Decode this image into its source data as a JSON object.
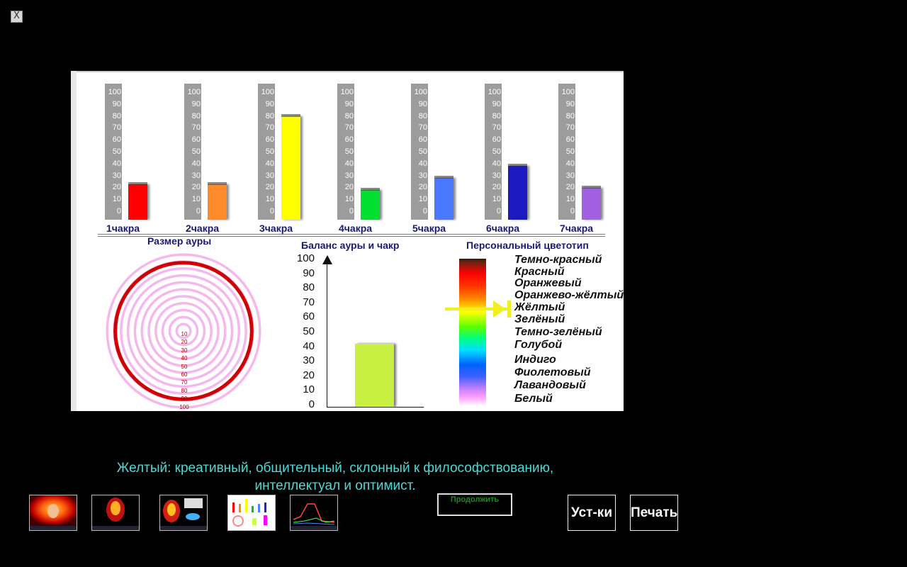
{
  "window": {
    "close_glyph": "X"
  },
  "chakras": {
    "scale_ticks": [
      "100",
      "90",
      "80",
      "70",
      "60",
      "50",
      "40",
      "30",
      "20",
      "10",
      "0"
    ],
    "items": [
      {
        "label": "1чакра",
        "value": 30,
        "color": "#ff0000"
      },
      {
        "label": "2чакра",
        "value": 30,
        "color": "#ff8a2a"
      },
      {
        "label": "3чакра",
        "value": 87,
        "color": "#ffff00"
      },
      {
        "label": "4чакра",
        "value": 25,
        "color": "#00e030"
      },
      {
        "label": "5чакра",
        "value": 35,
        "color": "#4a78ff"
      },
      {
        "label": "6чакра",
        "value": 45,
        "color": "#1a1ac0"
      },
      {
        "label": "7чакра",
        "value": 27,
        "color": "#a060e0"
      }
    ]
  },
  "aura": {
    "title": "Размер ауры",
    "ticks": [
      "10",
      "20",
      "30",
      "40",
      "50",
      "60",
      "70",
      "80",
      "90",
      "100"
    ],
    "ring_value": 90,
    "ring_color": "#d00000"
  },
  "balance": {
    "title": "Баланс ауры и чакр",
    "ticks": [
      "100",
      "90",
      "80",
      "70",
      "60",
      "50",
      "40",
      "30",
      "20",
      "10",
      "0"
    ],
    "value": 43,
    "bar_color": "#c8f040"
  },
  "color_type": {
    "title": "Персональный цветотип",
    "colors": [
      "Темно-красный",
      "Красный",
      "Оранжевый",
      "Оранжево-жёлтый",
      "Жёлтый",
      "Зелёный",
      "Темно-зелёный",
      "Голубой",
      "Индиго",
      "Фиолетовый",
      "Лавандовый",
      "Белый"
    ],
    "selected": "Жёлтый",
    "marker_color": "#f0f020"
  },
  "description": {
    "line1": "Желтый: креативный, общительный, склонный к философствованию,",
    "line2": "интеллектуал и оптимист."
  },
  "buttons": {
    "continue": "Продолжить",
    "settings": "Уст-ки",
    "print": "Печать"
  }
}
